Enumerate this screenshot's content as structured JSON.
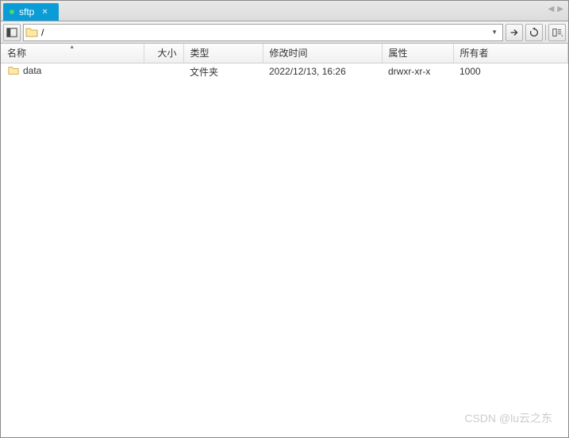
{
  "tab": {
    "label": "sftp"
  },
  "toolbar": {
    "path": "/"
  },
  "columns": {
    "name": "名称",
    "size": "大小",
    "type": "类型",
    "mtime": "修改时间",
    "attr": "属性",
    "owner": "所有者"
  },
  "rows": [
    {
      "name": "data",
      "size": "",
      "type": "文件夹",
      "mtime": "2022/12/13, 16:26",
      "attr": "drwxr-xr-x",
      "owner": "1000"
    }
  ],
  "watermark": "CSDN @lu云之东"
}
